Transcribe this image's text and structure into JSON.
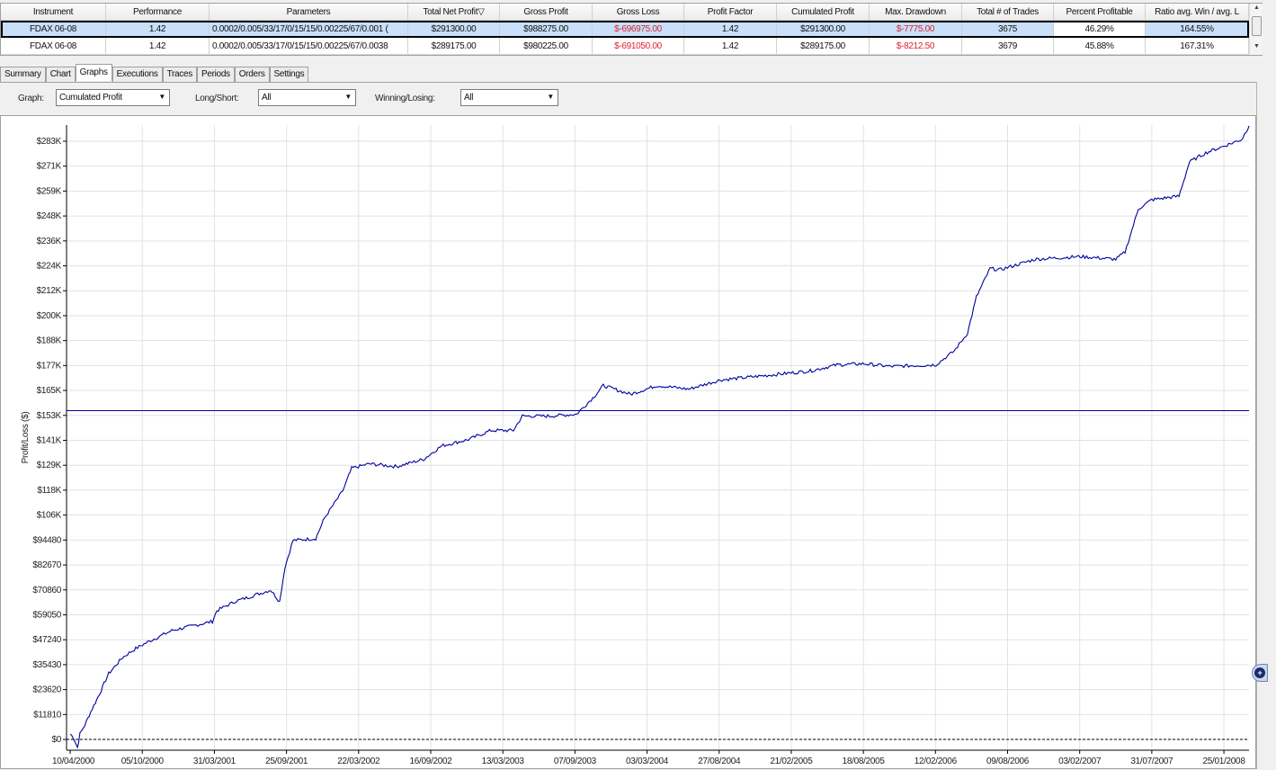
{
  "grid": {
    "columns": [
      "Instrument",
      "Performance",
      "Parameters",
      "Total Net Profit",
      "Gross Profit",
      "Gross Loss",
      "Profit Factor",
      "Cumulated Profit",
      "Max. Drawdown",
      "Total # of Trades",
      "Percent Profitable",
      "Ratio avg. Win / avg. L"
    ],
    "sort_icon": "triangle-down-icon",
    "rows": [
      [
        "FDAX 06-08",
        "1.42",
        "0.0002/0.005/33/17/0/15/15/0.00225/67/0.001 (",
        "$291300.00",
        "$988275.00",
        "$-696975.00",
        "1.42",
        "$291300.00",
        "$-7775.00",
        "3675",
        "46.29%",
        "164.55%"
      ],
      [
        "FDAX 06-08",
        "1.42",
        "0.0002/0.005/33/17/0/15/15/0.00225/67/0.0038",
        "$289175.00",
        "$980225.00",
        "$-691050.00",
        "1.42",
        "$289175.00",
        "$-8212.50",
        "3679",
        "45.88%",
        "167.31%"
      ]
    ]
  },
  "tabs": [
    "Summary",
    "Chart",
    "Graphs",
    "Executions",
    "Traces",
    "Periods",
    "Orders",
    "Settings"
  ],
  "active_tab": "Graphs",
  "toolbar": {
    "graph_label": "Graph:",
    "graph_value": "Cumulated Profit",
    "longshort_label": "Long/Short:",
    "longshort_value": "All",
    "winlose_label": "Winning/Losing:",
    "winlose_value": "All"
  },
  "colors": {
    "line": "#0000a0",
    "selected_row": "#c8e0fa",
    "negative": "#e0202a"
  },
  "chart_data": {
    "type": "line",
    "ylabel": "Profit/Loss ($)",
    "x_unit": "days since 10/04/2000",
    "xlim": [
      -9,
      2910
    ],
    "ylim": [
      -5.1,
      291.1
    ],
    "y_unit": "$K",
    "yticks": [
      {
        "v": 0,
        "l": "$0"
      },
      {
        "v": 11.81,
        "l": "$11810"
      },
      {
        "v": 23.62,
        "l": "$23620"
      },
      {
        "v": 35.43,
        "l": "$35430"
      },
      {
        "v": 47.24,
        "l": "$47240"
      },
      {
        "v": 59.05,
        "l": "$59050"
      },
      {
        "v": 70.86,
        "l": "$70860"
      },
      {
        "v": 82.67,
        "l": "$82670"
      },
      {
        "v": 94.48,
        "l": "$94480"
      },
      {
        "v": 106.29,
        "l": "$106K"
      },
      {
        "v": 118.1,
        "l": "$118K"
      },
      {
        "v": 129.91,
        "l": "$129K"
      },
      {
        "v": 141.72,
        "l": "$141K"
      },
      {
        "v": 153.53,
        "l": "$153K"
      },
      {
        "v": 165.34,
        "l": "$165K"
      },
      {
        "v": 177.15,
        "l": "$177K"
      },
      {
        "v": 188.96,
        "l": "$188K"
      },
      {
        "v": 200.77,
        "l": "$200K"
      },
      {
        "v": 212.58,
        "l": "$212K"
      },
      {
        "v": 224.39,
        "l": "$224K"
      },
      {
        "v": 236.2,
        "l": "$236K"
      },
      {
        "v": 248.01,
        "l": "$248K"
      },
      {
        "v": 259.82,
        "l": "$259K"
      },
      {
        "v": 271.63,
        "l": "$271K"
      },
      {
        "v": 283.44,
        "l": "$283K"
      }
    ],
    "xticks": [
      {
        "v": 0,
        "l": "10/04/2000"
      },
      {
        "v": 178,
        "l": "05/10/2000"
      },
      {
        "v": 356,
        "l": "31/03/2001"
      },
      {
        "v": 534,
        "l": "25/09/2001"
      },
      {
        "v": 712,
        "l": "22/03/2002"
      },
      {
        "v": 890,
        "l": "16/09/2002"
      },
      {
        "v": 1068,
        "l": "13/03/2003"
      },
      {
        "v": 1246,
        "l": "07/09/2003"
      },
      {
        "v": 1424,
        "l": "03/03/2004"
      },
      {
        "v": 1602,
        "l": "27/08/2004"
      },
      {
        "v": 1780,
        "l": "21/02/2005"
      },
      {
        "v": 1958,
        "l": "18/08/2005"
      },
      {
        "v": 2136,
        "l": "12/02/2006"
      },
      {
        "v": 2314,
        "l": "09/08/2006"
      },
      {
        "v": 2492,
        "l": "03/02/2007"
      },
      {
        "v": 2670,
        "l": "31/07/2007"
      },
      {
        "v": 2848,
        "l": "25/01/2008"
      }
    ],
    "reference_line": 155.8,
    "zero_line": 0,
    "series": [
      {
        "name": "Cumulated Profit",
        "points": [
          [
            0,
            2.6
          ],
          [
            7,
            1.3
          ],
          [
            18,
            -3.8
          ],
          [
            24,
            2.6
          ],
          [
            36,
            6.8
          ],
          [
            51,
            13.2
          ],
          [
            73,
            21.8
          ],
          [
            95,
            31.2
          ],
          [
            129,
            38.8
          ],
          [
            162,
            43.1
          ],
          [
            195,
            46.5
          ],
          [
            251,
            51.6
          ],
          [
            351,
            55.9
          ],
          [
            362,
            61.0
          ],
          [
            406,
            65.3
          ],
          [
            495,
            70.8
          ],
          [
            517,
            65.3
          ],
          [
            530,
            81.5
          ],
          [
            550,
            94.3
          ],
          [
            606,
            95.2
          ],
          [
            628,
            105.0
          ],
          [
            673,
            117.8
          ],
          [
            695,
            128.5
          ],
          [
            739,
            130.6
          ],
          [
            806,
            129.3
          ],
          [
            872,
            132.7
          ],
          [
            917,
            139.1
          ],
          [
            983,
            142.1
          ],
          [
            1039,
            146.4
          ],
          [
            1094,
            146.4
          ],
          [
            1116,
            153.2
          ],
          [
            1183,
            153.2
          ],
          [
            1250,
            154.1
          ],
          [
            1294,
            162.6
          ],
          [
            1316,
            167.7
          ],
          [
            1383,
            163.5
          ],
          [
            1449,
            167.7
          ],
          [
            1527,
            166.0
          ],
          [
            1605,
            170.3
          ],
          [
            1716,
            172.4
          ],
          [
            1827,
            174.6
          ],
          [
            1893,
            177.5
          ],
          [
            1960,
            178.0
          ],
          [
            2026,
            176.7
          ],
          [
            2137,
            177.5
          ],
          [
            2182,
            184.0
          ],
          [
            2215,
            192.5
          ],
          [
            2237,
            209.6
          ],
          [
            2271,
            223.2
          ],
          [
            2293,
            222.4
          ],
          [
            2382,
            227.5
          ],
          [
            2493,
            228.8
          ],
          [
            2581,
            227.5
          ],
          [
            2604,
            230.9
          ],
          [
            2637,
            251.4
          ],
          [
            2670,
            255.7
          ],
          [
            2737,
            257.4
          ],
          [
            2763,
            273.6
          ],
          [
            2803,
            277.9
          ],
          [
            2892,
            284.3
          ],
          [
            2910,
            290.7
          ]
        ]
      }
    ]
  }
}
